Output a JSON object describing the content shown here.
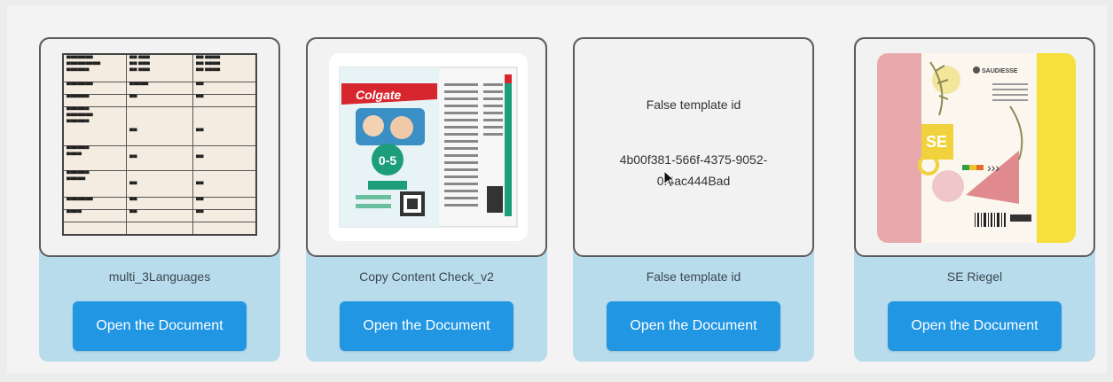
{
  "cards": [
    {
      "title": "multi_3Languages",
      "button": "Open the Document"
    },
    {
      "title": "Copy Content Check_v2",
      "button": "Open the Document",
      "brand": "Colgate",
      "age": "0-5"
    },
    {
      "title": "False template id",
      "button": "Open the Document",
      "preview_label": "False template id",
      "preview_id": "4b00f381-566f-4375-9052-0f4ac444Bad"
    },
    {
      "title": "SE Riegel",
      "button": "Open the Document",
      "logo_text": "SAUDIESSE",
      "badge": "SE"
    }
  ],
  "colors": {
    "button": "#2196e3",
    "card_footer": "#b9dcec",
    "thumb_border": "#5c5c5c"
  }
}
